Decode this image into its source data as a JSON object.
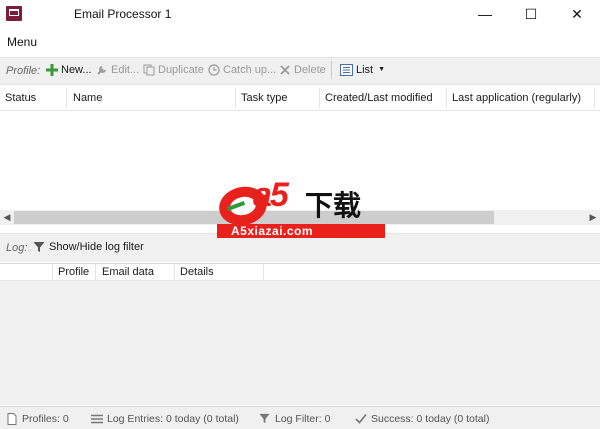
{
  "window": {
    "title": "Email Processor 1",
    "minimize_symbol": "—",
    "maximize_symbol": "☐",
    "close_symbol": "✕"
  },
  "menu": {
    "label": "Menu"
  },
  "toolbar": {
    "section_label": "Profile:",
    "new_label": "New...",
    "edit_label": "Edit...",
    "duplicate_label": "Duplicate",
    "catchup_label": "Catch up...",
    "delete_label": "Delete",
    "view_label": "List",
    "icons": {
      "new": "plus-icon",
      "edit": "wrench-icon",
      "duplicate": "duplicate-icon",
      "catchup": "clock-icon",
      "delete": "x-icon",
      "view": "list-icon"
    }
  },
  "profiles_table": {
    "columns": [
      "Status",
      "Name",
      "Task type",
      "Created/Last modified",
      "Last application (regularly)"
    ]
  },
  "log": {
    "section_label": "Log:",
    "filter_label": "Show/Hide log filter",
    "columns": [
      "Profile",
      "Email data",
      "Details"
    ]
  },
  "statusbar": {
    "profiles": "Profiles: 0",
    "log_entries": "Log Entries: 0 today (0 total)",
    "log_filter": "Log Filter: 0",
    "success": "Success: 0 today (0 total)"
  },
  "watermark": {
    "brand": "a5",
    "chinese": "下载",
    "domain": "A5xiazai.com"
  },
  "colors": {
    "accent_green": "#3a9a3a",
    "app_icon": "#7a1e3c",
    "watermark_red": "#e8211c"
  }
}
